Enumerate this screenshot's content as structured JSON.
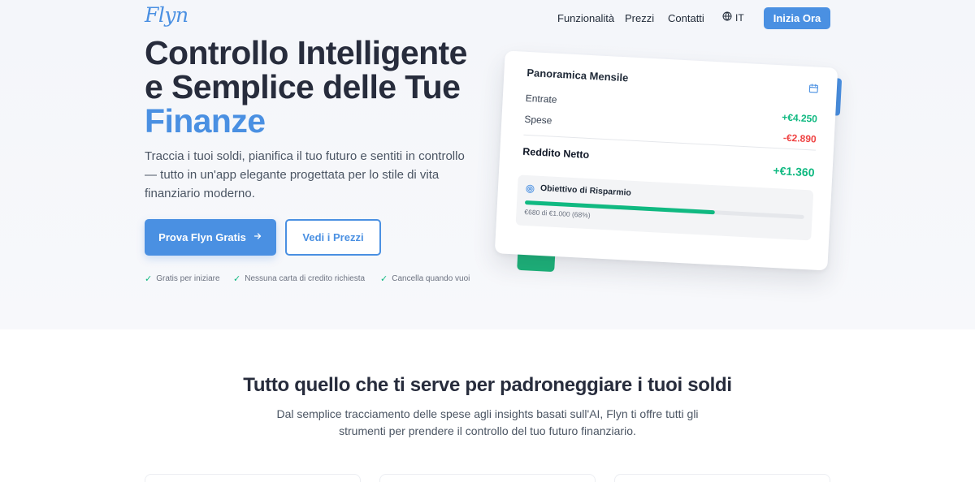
{
  "nav": {
    "logo": "Flyn",
    "links": [
      "Funzionalità",
      "Prezzi",
      "Contatti"
    ],
    "language": "IT",
    "cta": "Inizia Ora"
  },
  "hero": {
    "title_line1": "Controllo Intelligente",
    "title_line2": "e Semplice delle Tue",
    "title_accent": "Finanze",
    "lead": "Traccia i tuoi soldi, pianifica il tuo futuro e sentiti in controllo — tutto in un'app elegante progettata per lo stile di vita finanziario moderno.",
    "primary_button": "Prova Flyn Gratis",
    "secondary_button": "Vedi i Prezzi",
    "perks": [
      "Gratis per iniziare",
      "Nessuna carta di credito richiesta",
      "Cancella quando vuoi"
    ]
  },
  "card": {
    "title": "Panoramica Mensile",
    "income_label": "Entrate",
    "income_value": "+€4.250",
    "expenses_label": "Spese",
    "expenses_value": "-€2.890",
    "net_label": "Reddito Netto",
    "net_value": "+€1.360",
    "goal_title": "Obiettivo di Risparmio",
    "goal_caption": "€680 di €1.000 (68%)",
    "goal_progress": 0.68
  },
  "features": {
    "title": "Tutto quello che ti serve per padroneggiare i tuoi soldi",
    "subtitle": "Dal semplice tracciamento delle spese agli insights basati sull'AI, Flyn ti offre tutti gli strumenti per prendere il controllo del tuo futuro finanziario."
  },
  "colors": {
    "accent": "#4a90e2",
    "positive": "#10b981",
    "negative": "#ef4444"
  }
}
